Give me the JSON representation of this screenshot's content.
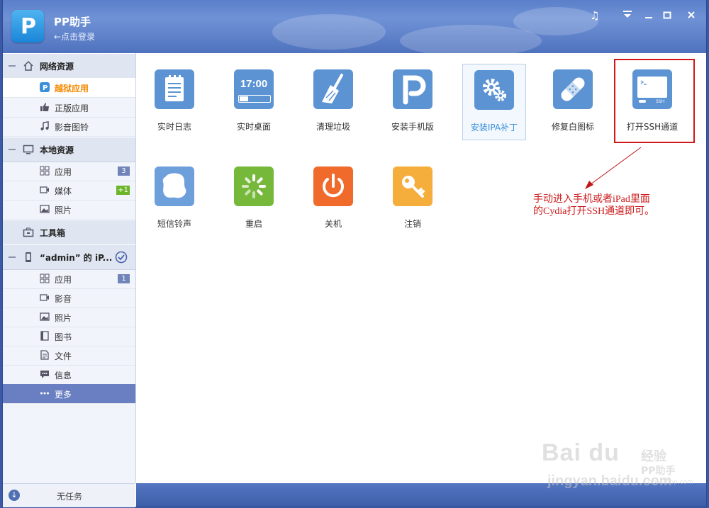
{
  "app": {
    "title": "PP助手",
    "login_link": "←点击登录"
  },
  "window_controls": [
    "music-icon",
    "menu-icon",
    "minimize-icon",
    "maximize-icon",
    "close-icon"
  ],
  "sidebar": {
    "groups": [
      {
        "label": "网络资源",
        "icon": "home-icon",
        "items": [
          {
            "label": "越狱应用",
            "icon": "pp-logo-icon",
            "active": true
          },
          {
            "label": "正版应用",
            "icon": "thumbs-up-icon"
          },
          {
            "label": "影音图铃",
            "icon": "music-note-icon"
          }
        ]
      },
      {
        "label": "本地资源",
        "icon": "monitor-icon",
        "items": [
          {
            "label": "应用",
            "icon": "grid-icon",
            "badge": "3"
          },
          {
            "label": "媒体",
            "icon": "video-icon",
            "badge": "+1"
          },
          {
            "label": "照片",
            "icon": "photo-icon"
          }
        ]
      },
      {
        "label": "工具箱",
        "icon": "toolbox-icon",
        "items": []
      },
      {
        "label": "“admin” 的 iP...",
        "icon": "phone-icon",
        "check": true,
        "items": [
          {
            "label": "应用",
            "icon": "grid-icon",
            "badge": "1"
          },
          {
            "label": "影音",
            "icon": "video-icon"
          },
          {
            "label": "照片",
            "icon": "photo-icon"
          },
          {
            "label": "图书",
            "icon": "book-icon"
          },
          {
            "label": "文件",
            "icon": "file-icon"
          },
          {
            "label": "信息",
            "icon": "message-icon"
          },
          {
            "label": "更多",
            "icon": "more-dots-icon",
            "selected": true
          }
        ]
      }
    ],
    "status": "无任务"
  },
  "tools": {
    "row1": [
      {
        "label": "实时日志",
        "icon": "notepad-icon",
        "color": "#5c93d3"
      },
      {
        "label": "实时桌面",
        "icon": "clock-screen-icon",
        "color": "#5c93d3",
        "time": "17:00"
      },
      {
        "label": "清理垃圾",
        "icon": "broom-icon",
        "color": "#5c93d3"
      },
      {
        "label": "安装手机版",
        "icon": "pp-logo-icon",
        "color": "#5c93d3"
      },
      {
        "label": "安装IPA补丁",
        "icon": "gears-icon",
        "color": "#5c93d3",
        "selected": true
      },
      {
        "label": "修复白图标",
        "icon": "bandage-icon",
        "color": "#5c93d3"
      },
      {
        "label": "打开SSH通道",
        "icon": "terminal-icon",
        "color": "#5c93d3",
        "ssh": "SSH"
      }
    ],
    "row2": [
      {
        "label": "短信铃声",
        "icon": "bell-icon",
        "color": "#6d9fdb"
      },
      {
        "label": "重启",
        "icon": "restart-icon",
        "color": "#76b83a"
      },
      {
        "label": "关机",
        "icon": "power-icon",
        "color": "#f06a2c"
      },
      {
        "label": "注销",
        "icon": "key-icon",
        "color": "#f5ad3b"
      }
    ]
  },
  "annotation": {
    "line1": "手动进入手机或者iPad里面",
    "line2": "的Cydia打开SSH通道即可。"
  },
  "watermark": {
    "brand": "Bai du",
    "cn": "经验",
    "url": "jingyan.baidu.com",
    "pp": "PP助手",
    "pp_url": "bbs.25pp.com"
  }
}
